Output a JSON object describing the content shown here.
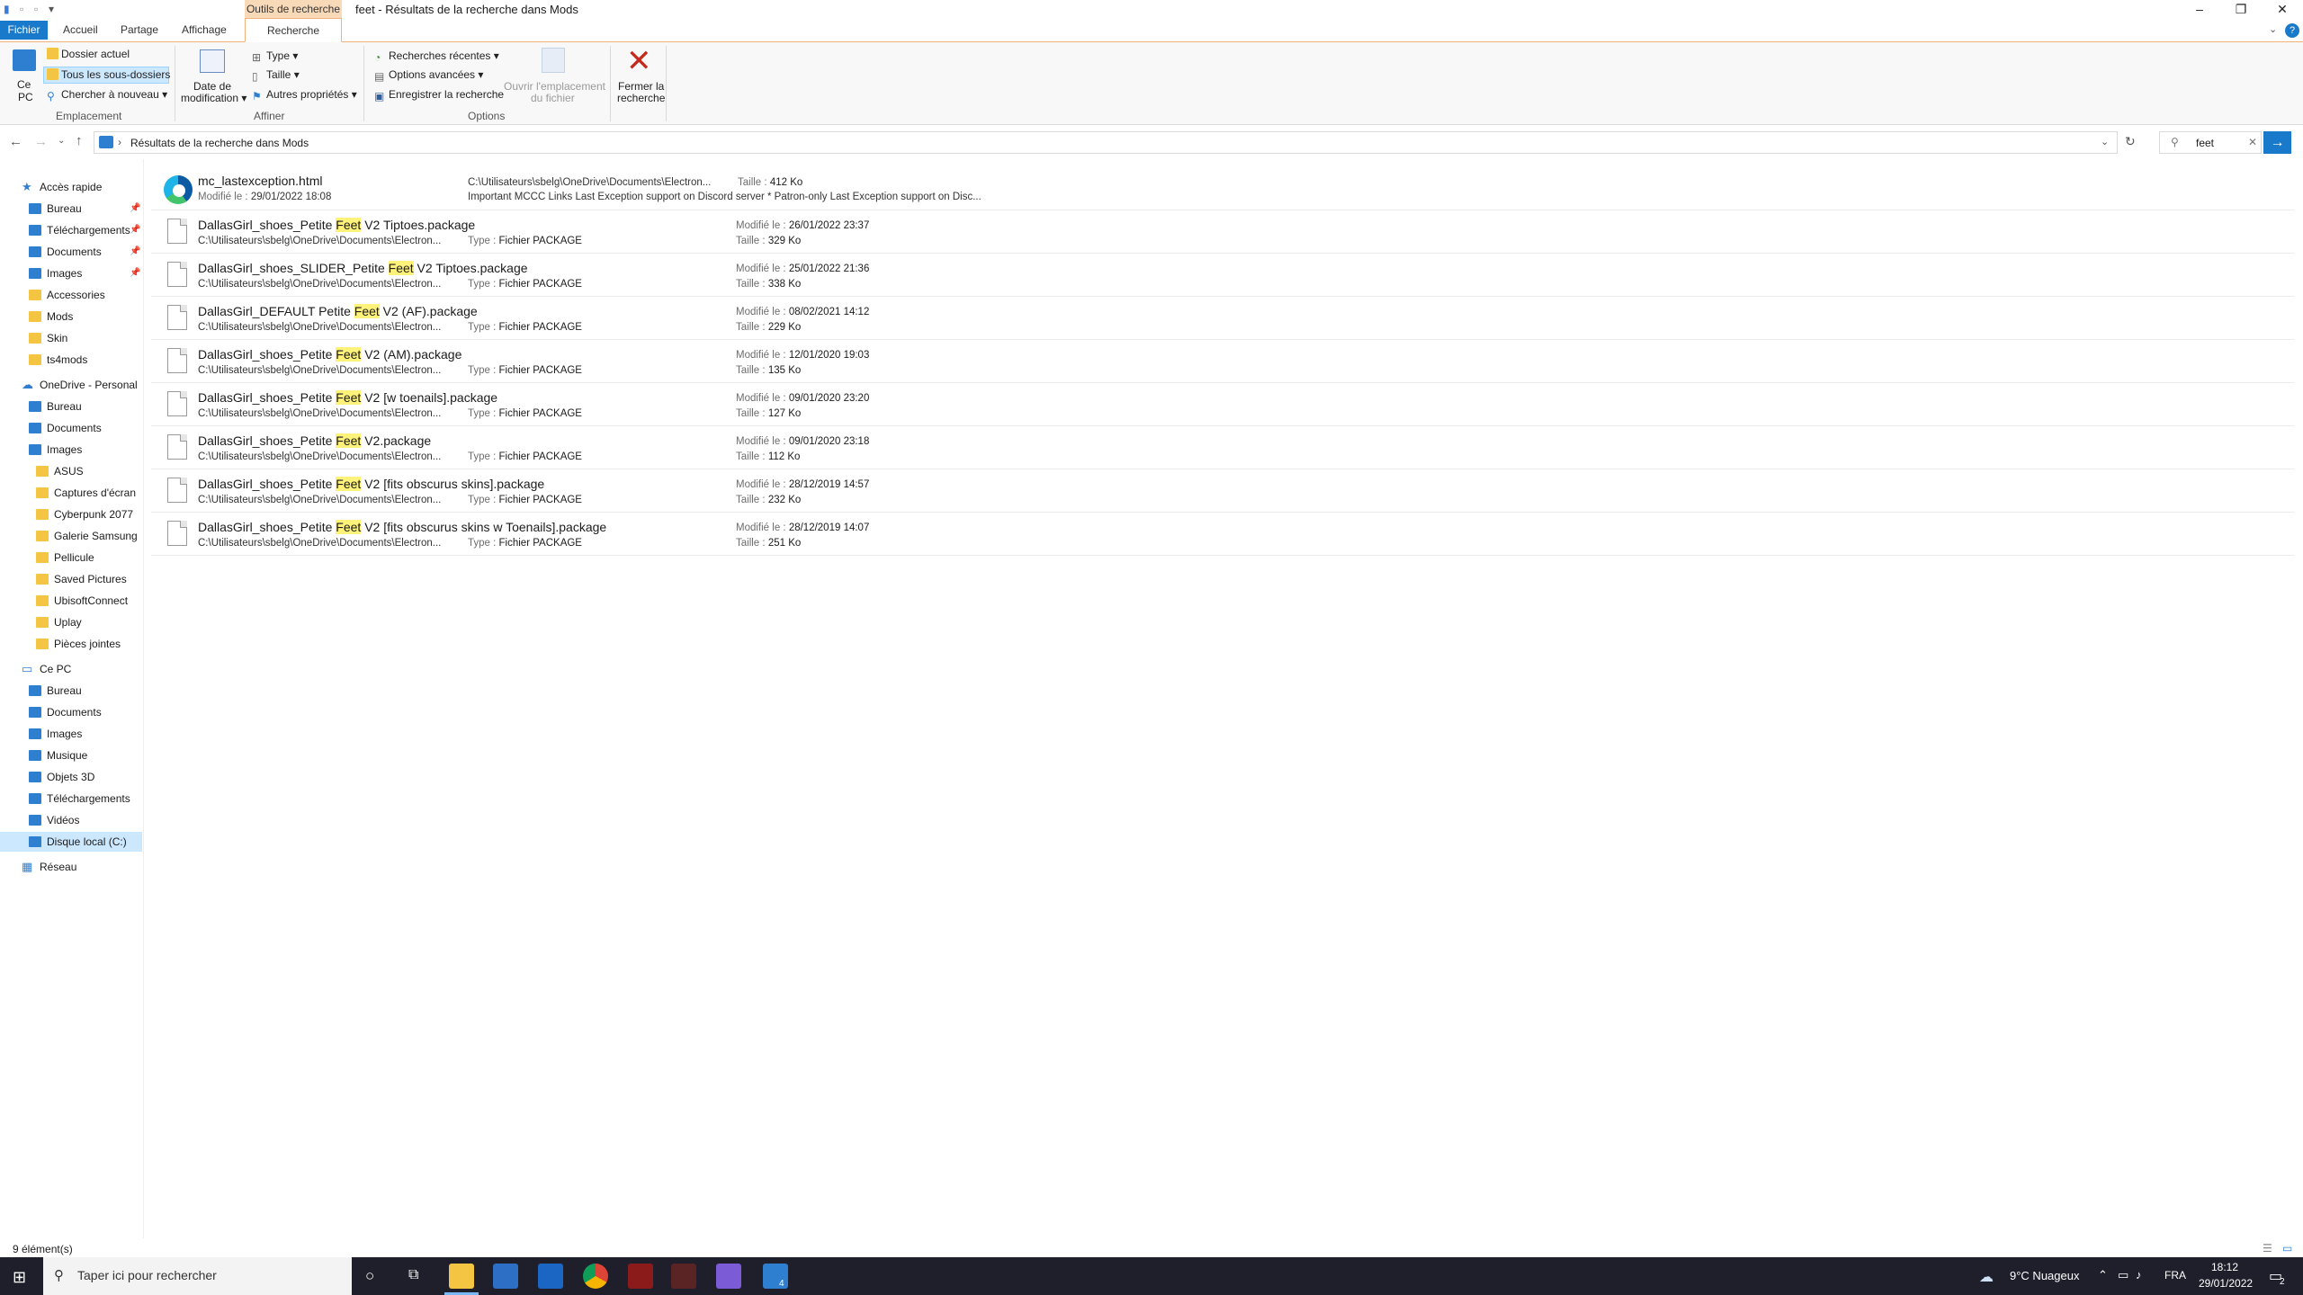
{
  "window": {
    "context_tab": "Outils de recherche",
    "title": "feet - Résultats de la recherche dans Mods"
  },
  "tabs": {
    "file": "Fichier",
    "home": "Accueil",
    "share": "Partage",
    "view": "Affichage",
    "search": "Recherche"
  },
  "ribbon": {
    "location": {
      "this_pc_line1": "Ce",
      "this_pc_line2": "PC",
      "current_folder": "Dossier actuel",
      "all_subfolders": "Tous les sous-dossiers",
      "search_again": "Chercher à nouveau",
      "label": "Emplacement"
    },
    "refine": {
      "date_mod_line1": "Date de",
      "date_mod_line2": "modification",
      "type": "Type",
      "size": "Taille",
      "other_props": "Autres propriétés",
      "label": "Affiner"
    },
    "options": {
      "recent": "Recherches récentes",
      "advanced": "Options avancées",
      "save": "Enregistrer la recherche",
      "open_loc_line1": "Ouvrir l'emplacement",
      "open_loc_line2": "du fichier",
      "label": "Options"
    },
    "close": {
      "line1": "Fermer la",
      "line2": "recherche"
    }
  },
  "address": {
    "path": "Résultats de la recherche dans Mods",
    "search_value": "feet"
  },
  "nav": {
    "quick_access": "Accès rapide",
    "quick": [
      "Bureau",
      "Téléchargements",
      "Documents",
      "Images",
      "Accessories",
      "Mods",
      "Skin",
      "ts4mods"
    ],
    "onedrive": "OneDrive - Personal",
    "od": [
      "Bureau",
      "Documents",
      "Images",
      "ASUS",
      "Captures d'écran",
      "Cyberpunk 2077",
      "Galerie Samsung",
      "Pellicule",
      "Saved Pictures",
      "UbisoftConnect",
      "Uplay",
      "Pièces jointes"
    ],
    "thispc": "Ce PC",
    "pc": [
      "Bureau",
      "Documents",
      "Images",
      "Musique",
      "Objets 3D",
      "Téléchargements",
      "Vidéos",
      "Disque local (C:)"
    ],
    "network": "Réseau"
  },
  "labels": {
    "modified": "Modifié le :",
    "size": "Taille :",
    "type": "Type :"
  },
  "files": [
    {
      "pre": "mc_lastexception.html",
      "hl": "",
      "post": "",
      "path": "C:\\Utilisateurs\\sbelg\\OneDrive\\Documents\\Electron...",
      "modified": "29/01/2022 18:08",
      "size": "412 Ko",
      "desc": "Important MCCC Links Last Exception support on Discord server * Patron-only Last Exception support on Disc..."
    },
    {
      "pre": "DallasGirl_shoes_Petite ",
      "hl": "Feet",
      "post": " V2 Tiptoes.package",
      "path": "C:\\Utilisateurs\\sbelg\\OneDrive\\Documents\\Electron...",
      "type": "Fichier PACKAGE",
      "modified": "26/01/2022 23:37",
      "size": "329 Ko"
    },
    {
      "pre": "DallasGirl_shoes_SLIDER_Petite ",
      "hl": "Feet",
      "post": " V2 Tiptoes.package",
      "path": "C:\\Utilisateurs\\sbelg\\OneDrive\\Documents\\Electron...",
      "type": "Fichier PACKAGE",
      "modified": "25/01/2022 21:36",
      "size": "338 Ko"
    },
    {
      "pre": "DallasGirl_DEFAULT Petite ",
      "hl": "Feet",
      "post": " V2 (AF).package",
      "path": "C:\\Utilisateurs\\sbelg\\OneDrive\\Documents\\Electron...",
      "type": "Fichier PACKAGE",
      "modified": "08/02/2021 14:12",
      "size": "229 Ko"
    },
    {
      "pre": "DallasGirl_shoes_Petite ",
      "hl": "Feet",
      "post": " V2 (AM).package",
      "path": "C:\\Utilisateurs\\sbelg\\OneDrive\\Documents\\Electron...",
      "type": "Fichier PACKAGE",
      "modified": "12/01/2020 19:03",
      "size": "135 Ko"
    },
    {
      "pre": "DallasGirl_shoes_Petite ",
      "hl": "Feet",
      "post": " V2 [w toenails].package",
      "path": "C:\\Utilisateurs\\sbelg\\OneDrive\\Documents\\Electron...",
      "type": "Fichier PACKAGE",
      "modified": "09/01/2020 23:20",
      "size": "127 Ko"
    },
    {
      "pre": "DallasGirl_shoes_Petite ",
      "hl": "Feet",
      "post": " V2.package",
      "path": "C:\\Utilisateurs\\sbelg\\OneDrive\\Documents\\Electron...",
      "type": "Fichier PACKAGE",
      "modified": "09/01/2020 23:18",
      "size": "112 Ko"
    },
    {
      "pre": "DallasGirl_shoes_Petite ",
      "hl": "Feet",
      "post": " V2 [fits obscurus skins].package",
      "path": "C:\\Utilisateurs\\sbelg\\OneDrive\\Documents\\Electron...",
      "type": "Fichier PACKAGE",
      "modified": "28/12/2019 14:57",
      "size": "232 Ko"
    },
    {
      "pre": "DallasGirl_shoes_Petite ",
      "hl": "Feet",
      "post": " V2 [fits obscurus skins w Toenails].package",
      "path": "C:\\Utilisateurs\\sbelg\\OneDrive\\Documents\\Electron...",
      "type": "Fichier PACKAGE",
      "modified": "28/12/2019 14:07",
      "size": "251 Ko"
    }
  ],
  "status": {
    "count": "9 élément(s)"
  },
  "taskbar": {
    "search_placeholder": "Taper ici pour rechercher",
    "weather": "9°C  Nuageux",
    "lang": "FRA",
    "time": "18:12",
    "date": "29/01/2022",
    "badge": "4",
    "notif": "2"
  },
  "colors": {
    "accent": "#1979ca",
    "context_tab": "#f8d9b8",
    "highlight": "#fff27a",
    "close_red": "#c42b1c"
  }
}
